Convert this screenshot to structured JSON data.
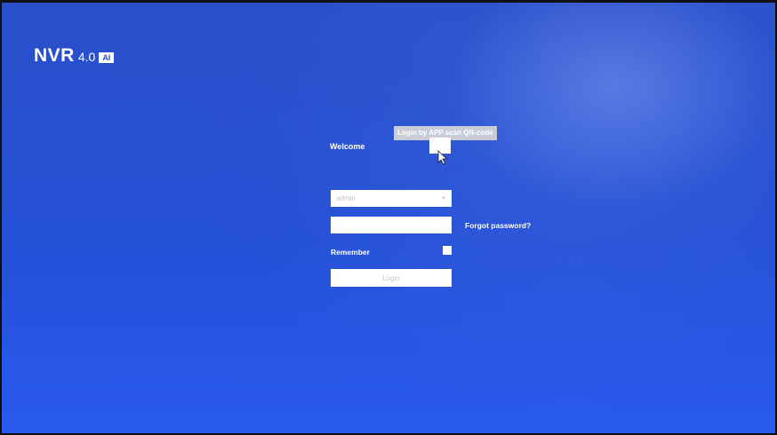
{
  "logo": {
    "brand": "NVR",
    "version": "4.0",
    "badge": "AI"
  },
  "login": {
    "welcome": "Welcome",
    "qr_tooltip": "Login by APP scan QR-code",
    "username_value": "admin",
    "password_value": "",
    "forgot_password": "Forgot password?",
    "remember_label": "Remember",
    "remember_checked": false,
    "login_button": "Login"
  },
  "icons": {
    "dropdown": "chevron-down-icon",
    "pointer": "mouse-cursor-icon"
  },
  "colors": {
    "background": "#2450d6",
    "text": "#ffffff",
    "placeholder_text": "#c6c6c6",
    "tooltip_bg": "#c9cbd6"
  }
}
